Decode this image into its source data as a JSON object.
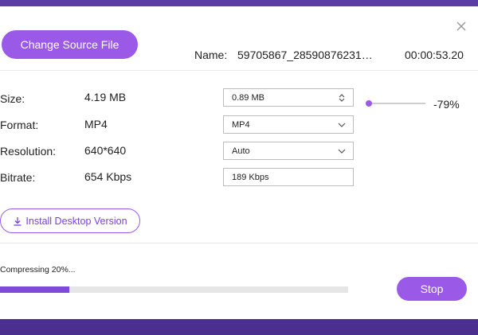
{
  "header": {
    "change_source_label": "Change Source File",
    "name_label": "Name:",
    "name_value": "59705867_28590876231…",
    "duration": "00:00:53.20"
  },
  "settings": {
    "size": {
      "label": "Size:",
      "value": "4.19 MB",
      "target": "0.89  MB",
      "percent": "-79%",
      "slider_level": 0.0
    },
    "format": {
      "label": "Format:",
      "value": "MP4",
      "target": "MP4"
    },
    "resolution": {
      "label": "Resolution:",
      "value": "640*640",
      "target": "Auto"
    },
    "bitrate": {
      "label": "Bitrate:",
      "value": "654 Kbps",
      "target": "189 Kbps"
    }
  },
  "install": {
    "label": "Install Desktop Version",
    "icon": "download-icon"
  },
  "progress": {
    "text": "Compressing 20%...",
    "value": 20
  },
  "footer": {
    "stop_label": "Stop"
  },
  "icons": {
    "close": "close-icon",
    "stepper": "up-down-stepper-icon",
    "dropdown": "chevron-down-icon"
  },
  "colors": {
    "accent": "#9b59e8",
    "progress": "#7d4bd8",
    "frame": "#5b3ea5"
  }
}
